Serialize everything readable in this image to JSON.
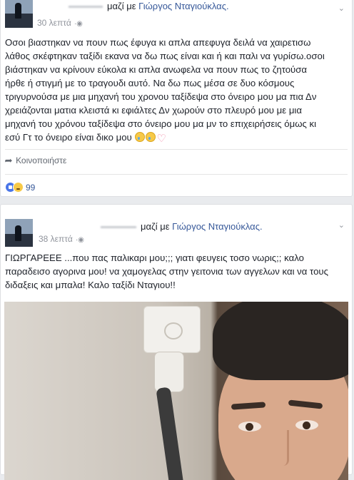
{
  "post1": {
    "with_text": "μαζί με",
    "friend_name": "Γιώργος Νταγιούκλας.",
    "time": "30 λεπτά",
    "lines": [
      "Οσοι βιαστηκαν να πουν πως έφυγα κι απλα απεφυγα δειλά να χαιρετισω",
      "λάθος σκέφτηκαν ταξίδι εκανα να δω πως είναι και ή και παλι να γυρίσω.οσοι",
      "βιάστηκαν να κρίνουν εύκολα κι απλα ανωφελα να πουν πως το ζητούσα",
      "ήρθε ή στιγμή με το τραγουδι αυτό. Να δω πως μέσα σε δυο κόσμους",
      "τριγυρνούσα με μια μηχανή του χρονου ταξίδεψα στο όνειρο μου μα πια Δν",
      "χρειάζονται ματια κλειστά κι εφιάλτες Δν χωρούν στο πλευρό μου με μια",
      "μηχανή του χρόνου ταξίδεψα στο όνειρο μου μα μν το επιχειρήσεις όμως κι",
      "εσύ Γτ το όνειρο είναι δικο μου"
    ],
    "share_label": "Κοινοποιήστε",
    "reaction_count": "99"
  },
  "post2": {
    "with_text": "μαζί με",
    "friend_name": "Γιώργος Νταγιούκλας.",
    "time": "38 λεπτά",
    "lines": [
      "ΓΙΩΡΓΑΡΕΕΕ ...που πας παλικαρι μου;;; γιατι φευγεις τοσο νωρις;; καλο",
      "παραδεισο αγορινα μου! να χαμογελας στην γειτονια των αγγελων και να τους",
      "διδαξεις και μπαλα! Καλο ταξίδι Νταγιου!!"
    ]
  },
  "icons": {
    "globe": "globe-icon",
    "chevron": "chevron-down-icon",
    "share": "share-arrow-icon",
    "like": "like-reaction-icon",
    "sad": "sad-reaction-icon",
    "crying": "crying-face-emoji",
    "heart": "pink-heart-emoji"
  },
  "colors": {
    "link": "#365899",
    "meta": "#90949c",
    "text": "#1d2129",
    "background": "#e9ebee"
  }
}
